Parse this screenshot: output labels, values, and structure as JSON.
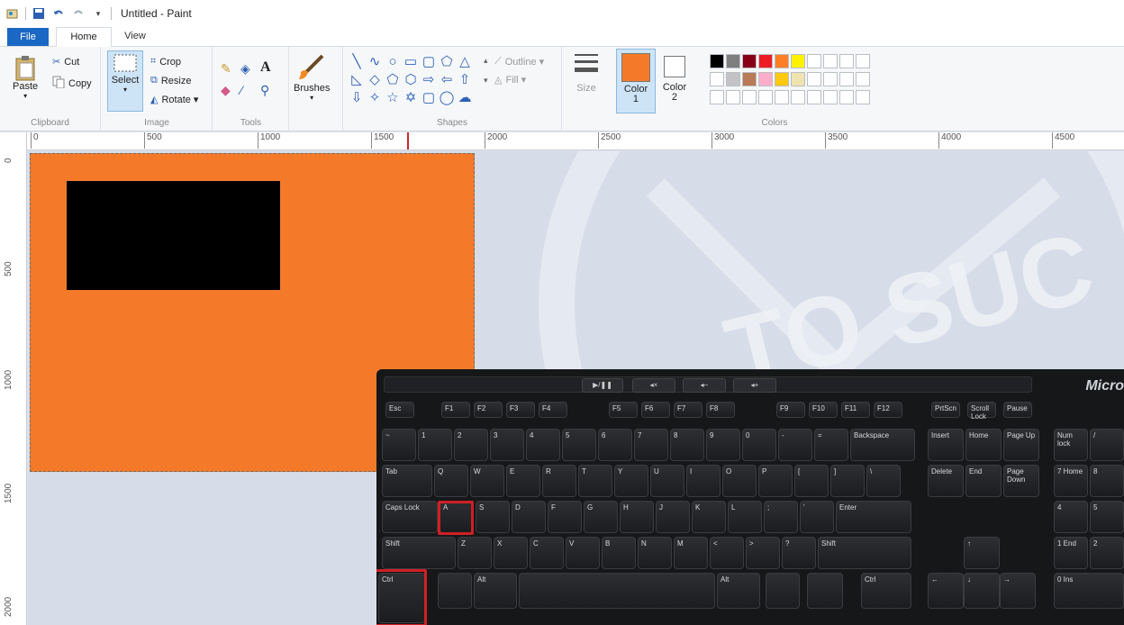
{
  "window": {
    "title": "Untitled - Paint"
  },
  "tabs": [
    {
      "label": "File"
    },
    {
      "label": "Home"
    },
    {
      "label": "View"
    }
  ],
  "clipboard": {
    "paste": "Paste",
    "cut": "Cut",
    "copy": "Copy",
    "label": "Clipboard"
  },
  "image": {
    "select": "Select",
    "crop": "Crop",
    "resize": "Resize",
    "rotate": "Rotate ▾",
    "label": "Image"
  },
  "tools": {
    "label": "Tools",
    "brushes": "Brushes",
    "text_icon": "A"
  },
  "shapes": {
    "outline": "Outline ▾",
    "fill": "Fill ▾",
    "label": "Shapes"
  },
  "size": {
    "label": "Size"
  },
  "color1": {
    "label": "Color\n1",
    "value": "#f47a2a"
  },
  "color2": {
    "label": "Color\n2"
  },
  "colors": {
    "label": "Colors",
    "row1": [
      "#000000",
      "#7f7f7f",
      "#880015",
      "#ed1c24",
      "#ff7f27",
      "#fff200"
    ],
    "row2": [
      "#ffffff",
      "#c3c3c3",
      "#b97a57",
      "#ffaec9",
      "#ffc90e",
      "#efe4b0"
    ]
  },
  "ruler": {
    "h": [
      "0",
      "500",
      "1000",
      "1500",
      "2000",
      "2500",
      "3000",
      "3500",
      "4000",
      "4500"
    ],
    "v": [
      "0",
      "500",
      "1000",
      "1500",
      "2000"
    ]
  },
  "keyboard": {
    "brand": "Micro",
    "highlighted": [
      "A",
      "Ctrl"
    ],
    "row0": [
      "Esc",
      "F1",
      "F2",
      "F3",
      "F4",
      "F5",
      "F6",
      "F7",
      "F8",
      "F9",
      "F10",
      "F11",
      "F12",
      "PrtScn",
      "Scroll Lock",
      "Pause"
    ],
    "row1": [
      "~",
      "1",
      "2",
      "3",
      "4",
      "5",
      "6",
      "7",
      "8",
      "9",
      "0",
      "-",
      "=",
      "Backspace"
    ],
    "row2": [
      "Tab",
      "Q",
      "W",
      "E",
      "R",
      "T",
      "Y",
      "U",
      "I",
      "O",
      "P",
      "[",
      "]",
      "\\"
    ],
    "row3": [
      "Caps Lock",
      "A",
      "S",
      "D",
      "F",
      "G",
      "H",
      "J",
      "K",
      "L",
      ";",
      "'",
      "Enter"
    ],
    "row4": [
      "Shift",
      "Z",
      "X",
      "C",
      "V",
      "B",
      "N",
      "M",
      "<",
      ">",
      "?",
      "Shift"
    ],
    "row5": [
      "Ctrl",
      "",
      "Alt",
      "",
      "Alt",
      "",
      "",
      "Ctrl"
    ],
    "nav": [
      "Insert",
      "Home",
      "Page Up",
      "Delete",
      "End",
      "Page Down"
    ],
    "numpad": [
      "Num lock",
      "/",
      "7",
      "8",
      "Home",
      "4",
      "5",
      "1",
      "2",
      "End",
      "0",
      "Ins"
    ]
  }
}
